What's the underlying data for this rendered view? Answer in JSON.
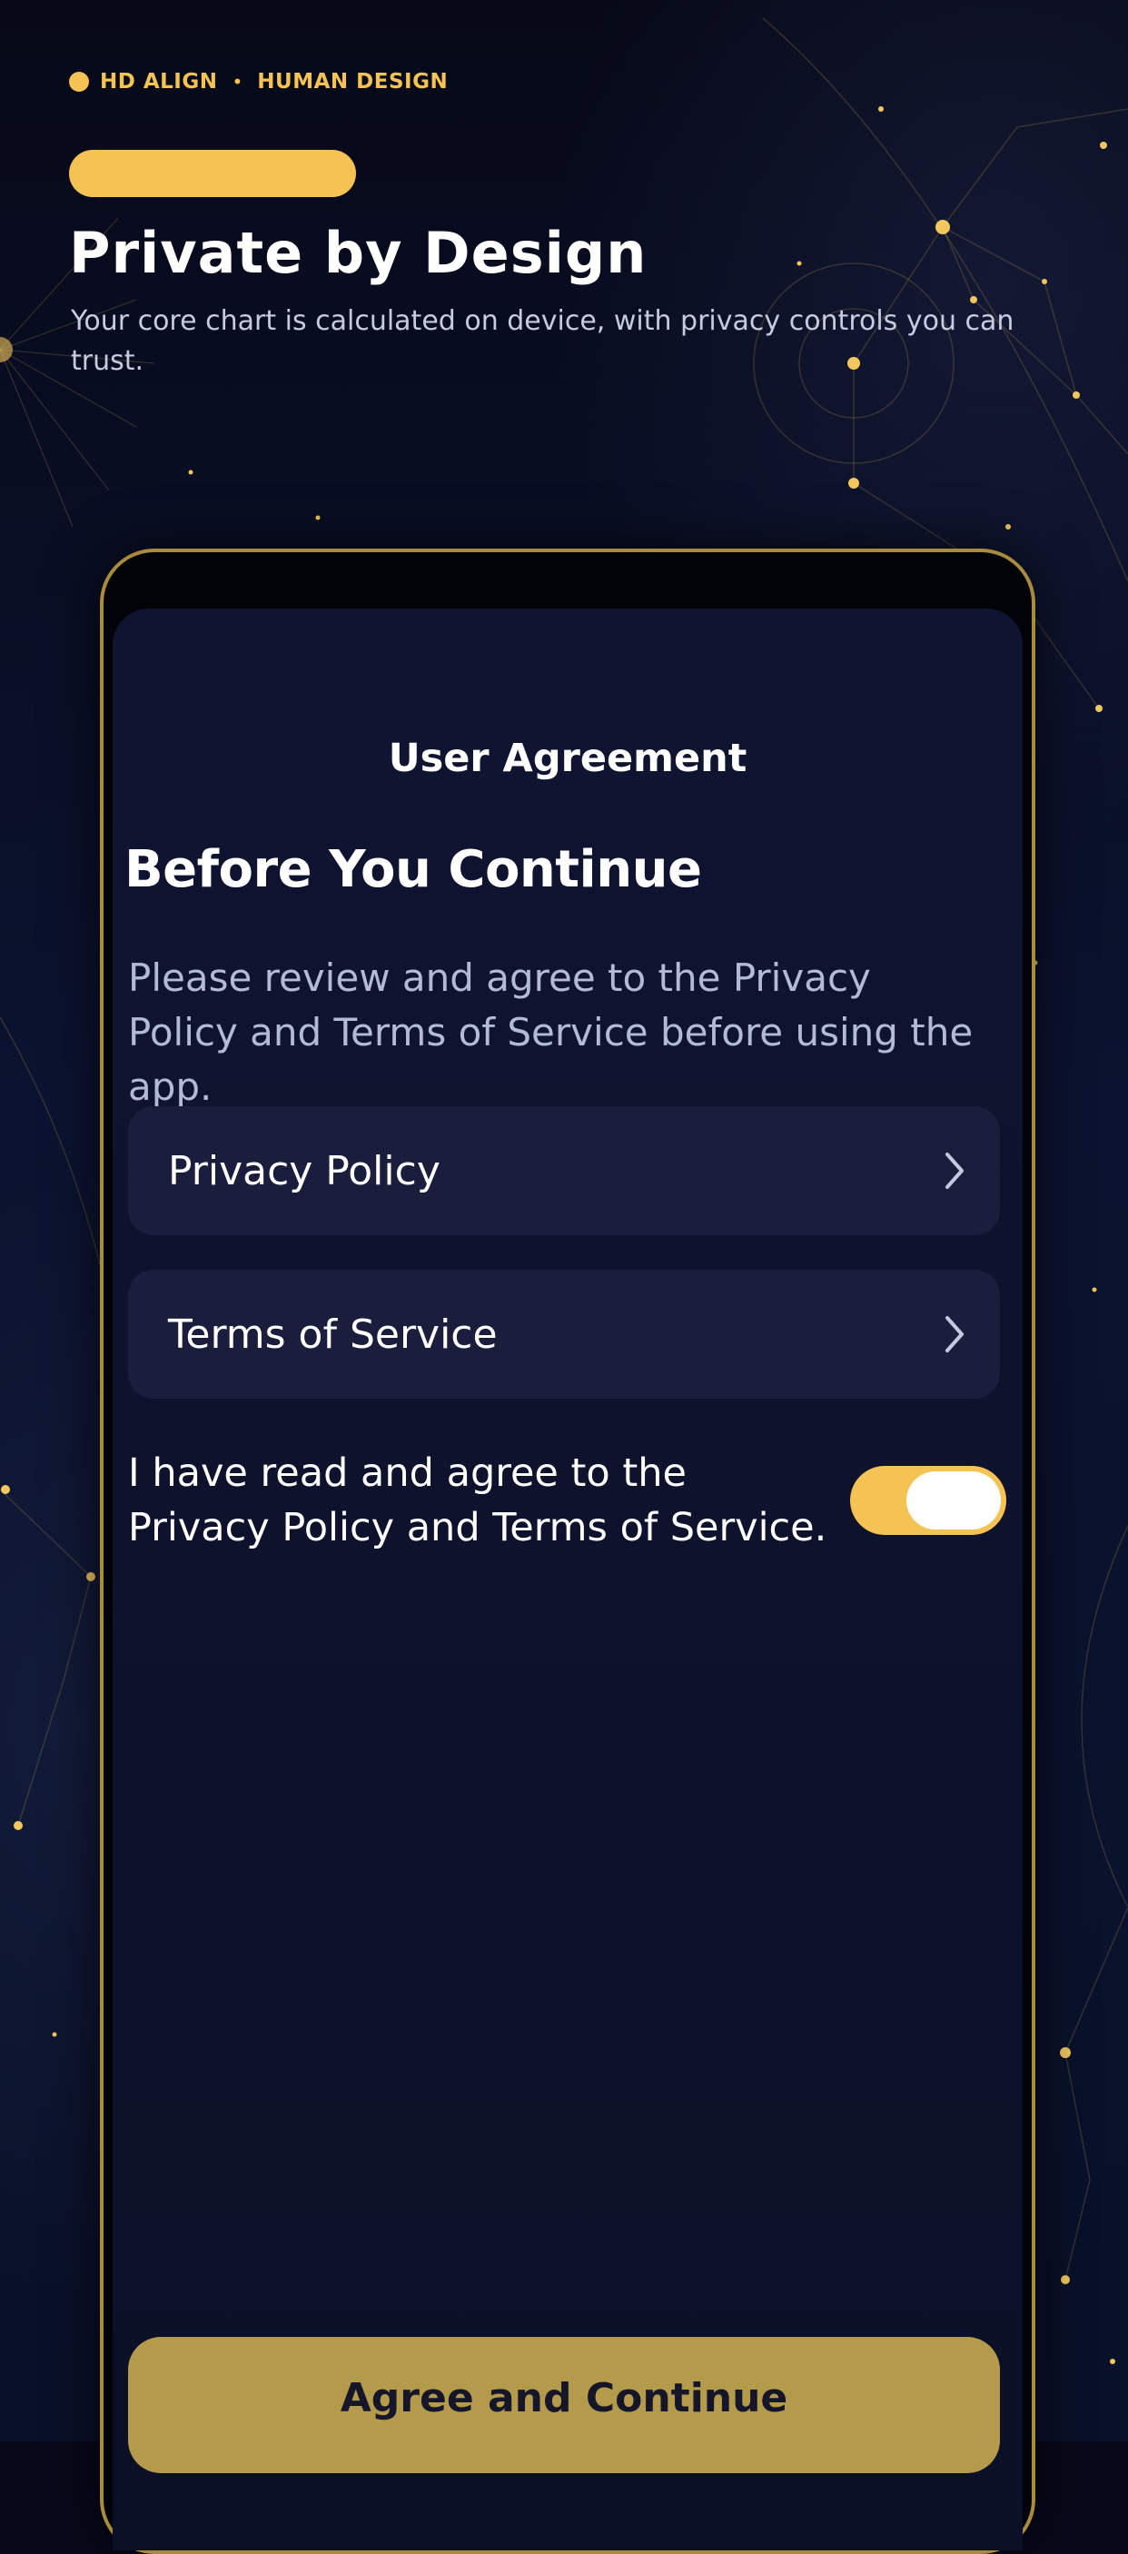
{
  "brand": {
    "name": "HD ALIGN",
    "separator": "•",
    "tagline": "HUMAN DESIGN"
  },
  "hero": {
    "title": "Private by Design",
    "subtitle": "Your core chart is calculated on device, with privacy controls you can trust."
  },
  "agreement": {
    "nav_title": "User Agreement",
    "heading": "Before You Continue",
    "description": "Please review and agree to the Privacy Policy and Terms of Service before using the app.",
    "links": [
      {
        "label": "Privacy Policy",
        "icon": "chevron-right-icon"
      },
      {
        "label": "Terms of Service",
        "icon": "chevron-right-icon"
      }
    ],
    "consent_text": "I have read and agree to the Privacy Policy and Terms of Service.",
    "consent_checked": true,
    "cta_label": "Agree and Continue"
  },
  "colors": {
    "accent": "#f4c353",
    "frame": "#a98b3e",
    "cta": "#b49b4b",
    "background": "#07091a",
    "card": "#1a1e3c"
  }
}
